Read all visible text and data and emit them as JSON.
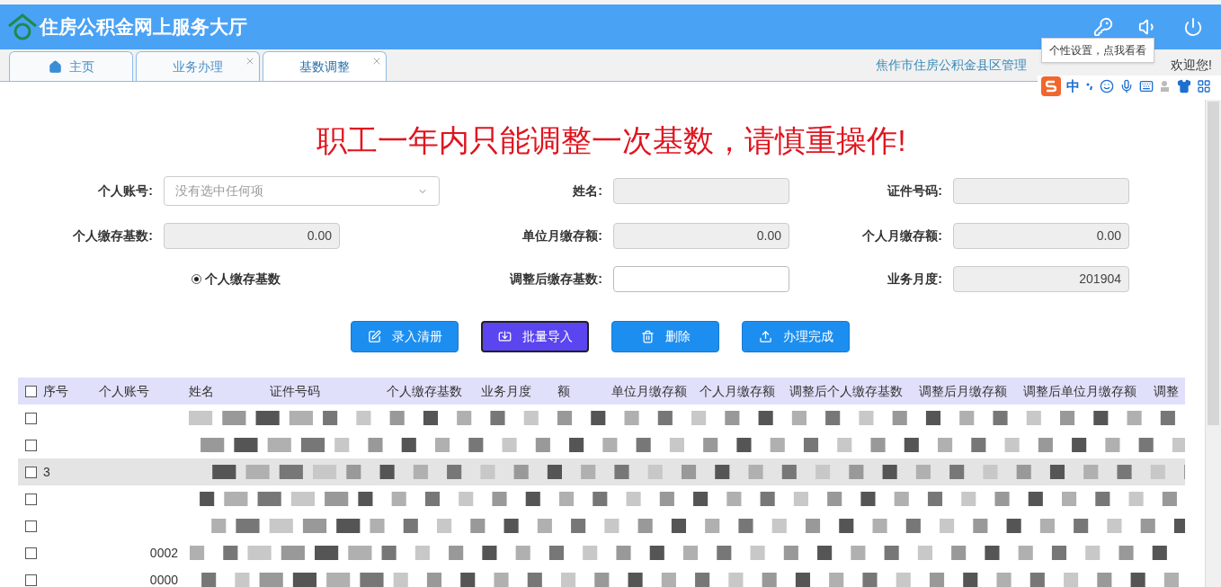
{
  "header": {
    "title": "住房公积金网上服务大厅"
  },
  "tabs": [
    {
      "label": "主页",
      "kind": "home",
      "selected": false,
      "closable": false
    },
    {
      "label": "业务办理",
      "kind": "plain",
      "selected": false,
      "closable": true
    },
    {
      "label": "基数调整",
      "kind": "plain",
      "selected": true,
      "closable": true
    }
  ],
  "org_text": "焦作市住房公积金县区管理",
  "welcome": "欢迎您!",
  "tooltip": "个性设置，点我看看",
  "ime": {
    "label": "中"
  },
  "warning": "职工一年内只能调整一次基数，请慎重操作!",
  "fields": [
    {
      "label": "个人账号:",
      "kind": "select",
      "placeholder": "没有选中任何项"
    },
    {
      "label": "姓名:",
      "kind": "readonly"
    },
    {
      "label": "证件号码:",
      "kind": "readonly"
    },
    {
      "label": "个人缴存基数:",
      "kind": "readonly",
      "value": "0.00"
    },
    {
      "label": "单位月缴存额:",
      "kind": "readonly",
      "value": "0.00"
    },
    {
      "label": "个人月缴存额:",
      "kind": "readonly",
      "value": "0.00"
    },
    {
      "label": "个人缴存基数",
      "kind": "radio",
      "selected": true
    },
    {
      "label": "调整后缴存基数:",
      "kind": "input"
    },
    {
      "label": "业务月度:",
      "kind": "readonly",
      "value": "201904"
    }
  ],
  "buttons": [
    {
      "label": "录入清册",
      "kind": "edit",
      "selected": false
    },
    {
      "label": "批量导入",
      "kind": "import",
      "selected": true
    },
    {
      "label": "删除",
      "kind": "delete",
      "selected": false
    },
    {
      "label": "办理完成",
      "kind": "upload",
      "selected": false
    }
  ],
  "table": {
    "all_checked": false,
    "columns": [
      "序号",
      "个人账号",
      "姓名",
      "证件号码",
      "个人缴存基数",
      "业务月度",
      "额",
      "单位月缴存额",
      "个人月缴存额",
      "调整后个人缴存基数",
      "调整后月缴存额",
      "调整后单位月缴存额",
      "调整"
    ],
    "rows": [
      {
        "checked": false
      },
      {
        "checked": false
      },
      {
        "checked": false,
        "seq": "3"
      },
      {
        "checked": false
      },
      {
        "checked": false
      },
      {
        "checked": false,
        "account": "0002"
      },
      {
        "checked": false,
        "account": "0000"
      }
    ]
  }
}
